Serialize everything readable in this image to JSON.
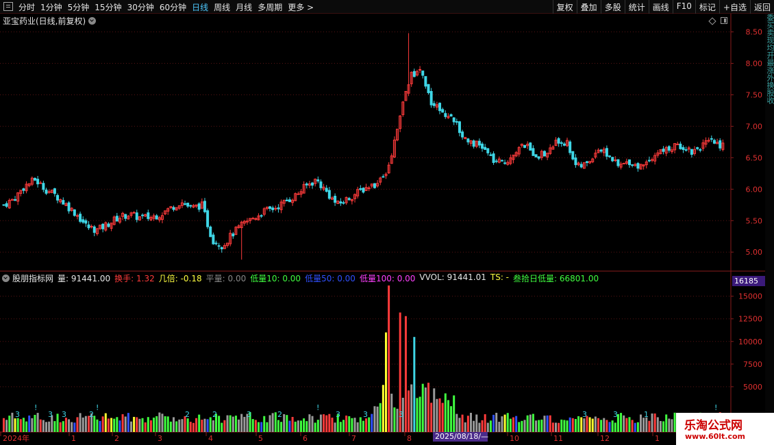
{
  "toolbar": {
    "periods": [
      "分时",
      "1分钟",
      "5分钟",
      "15分钟",
      "30分钟",
      "60分钟",
      "日线",
      "周线",
      "月线",
      "多周期",
      "更多 >"
    ],
    "active_period": "日线",
    "tools": [
      "复权",
      "叠加",
      "多股",
      "统计",
      "画线",
      "F10",
      "标记",
      "+自选",
      "返回"
    ]
  },
  "price_panel": {
    "title": "亚宝药业(日线,前复权)"
  },
  "indicator_panel": {
    "name": "股朋指标网",
    "items": [
      {
        "label": "量:",
        "value": "91441.00",
        "color": "#e6e6e6"
      },
      {
        "label": "换手:",
        "value": "1.32",
        "color": "#ff3b3b"
      },
      {
        "label": "几倍:",
        "value": "-0.18",
        "color": "#ffff40"
      },
      {
        "label": "平量:",
        "value": "0.00",
        "color": "#888888"
      },
      {
        "label": "低量10:",
        "value": "0.00",
        "color": "#40ff40"
      },
      {
        "label": "低量50:",
        "value": "0.00",
        "color": "#3050ff"
      },
      {
        "label": "低量100:",
        "value": "0.00",
        "color": "#ff40ff"
      },
      {
        "label": "VVOL:",
        "value": "91441.01",
        "color": "#e6e6e6"
      },
      {
        "label": "TS:",
        "value": "-",
        "color": "#ffff40"
      },
      {
        "label": "叁拾日低量:",
        "value": "66801.00",
        "color": "#40ff40"
      }
    ],
    "badge": "16185"
  },
  "right_strip": [
    "委",
    "买",
    "卖",
    "现",
    "均",
    "开",
    "最",
    "涨",
    "外",
    "换",
    "股",
    "收"
  ],
  "date_axis": {
    "labels": [
      "2024年",
      "1",
      "2",
      "3",
      "4",
      "5",
      "6",
      "7",
      "8",
      "9",
      "10",
      "11",
      "12",
      "1"
    ],
    "cursor_date": "2025/08/18/—"
  },
  "watermark": {
    "title": "乐淘公式网",
    "url": "www.60lt.com"
  },
  "colors": {
    "up": "#ff3b3b",
    "down": "#3fd6e6",
    "grid": "#5a1414",
    "axis": "#8a1c1c",
    "vol_bright": "#40ff40",
    "vol_yellow": "#ffff30",
    "vol_gray": "#9a9a9a"
  },
  "chart_data": {
    "type": "candlestick",
    "y_ticks": [
      "8.50",
      "8.00",
      "7.50",
      "7.00",
      "6.50",
      "6.00",
      "5.50",
      "5.00"
    ],
    "y_range": [
      4.85,
      8.55
    ],
    "vol_ticks": [
      "15000",
      "12500",
      "10000",
      "7500",
      "5000"
    ],
    "vol_range": [
      0,
      16185
    ],
    "close_path": [
      5.75,
      5.85,
      6.05,
      6.15,
      6.0,
      5.9,
      5.75,
      5.6,
      5.4,
      5.35,
      5.45,
      5.55,
      5.6,
      5.55,
      5.55,
      5.6,
      5.7,
      5.8,
      5.7,
      5.75,
      5.2,
      5.1,
      5.3,
      5.45,
      5.55,
      5.65,
      5.7,
      5.8,
      5.9,
      6.05,
      6.15,
      5.95,
      5.75,
      5.85,
      5.95,
      6.05,
      6.1,
      6.35,
      7.2,
      7.8,
      7.9,
      7.4,
      7.25,
      7.15,
      6.85,
      6.75,
      6.65,
      6.45,
      6.4,
      6.6,
      6.7,
      6.55,
      6.55,
      6.75,
      6.75,
      6.35,
      6.4,
      6.65,
      6.55,
      6.35,
      6.45,
      6.35,
      6.5,
      6.6,
      6.65,
      6.7,
      6.6,
      6.7,
      6.75,
      6.7
    ]
  }
}
